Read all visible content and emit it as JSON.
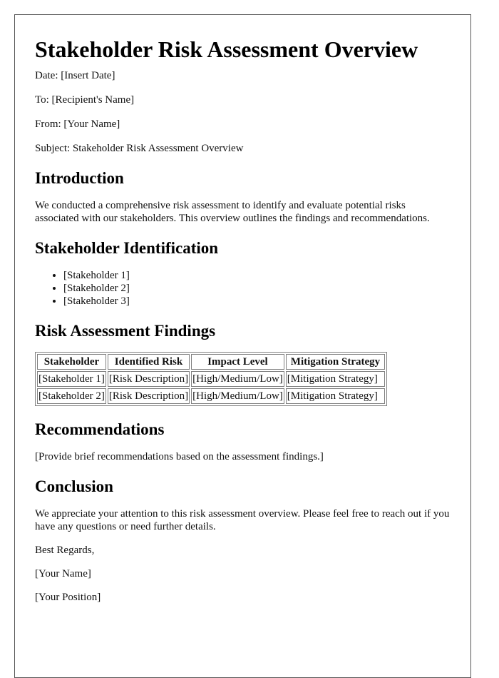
{
  "title": "Stakeholder Risk Assessment Overview",
  "meta": {
    "date": "Date: [Insert Date]",
    "to": "To: [Recipient's Name]",
    "from": "From: [Your Name]",
    "subject": "Subject: Stakeholder Risk Assessment Overview"
  },
  "introduction": {
    "heading": "Introduction",
    "body": "We conducted a comprehensive risk assessment to identify and evaluate potential risks associated with our stakeholders. This overview outlines the findings and recommendations."
  },
  "identification": {
    "heading": "Stakeholder Identification",
    "items": [
      "[Stakeholder 1]",
      "[Stakeholder 2]",
      "[Stakeholder 3]"
    ]
  },
  "findings": {
    "heading": "Risk Assessment Findings",
    "columns": [
      "Stakeholder",
      "Identified Risk",
      "Impact Level",
      "Mitigation Strategy"
    ],
    "rows": [
      [
        "[Stakeholder 1]",
        "[Risk Description]",
        "[High/Medium/Low]",
        "[Mitigation Strategy]"
      ],
      [
        "[Stakeholder 2]",
        "[Risk Description]",
        "[High/Medium/Low]",
        "[Mitigation Strategy]"
      ]
    ]
  },
  "recommendations": {
    "heading": "Recommendations",
    "body": "[Provide brief recommendations based on the assessment findings.]"
  },
  "conclusion": {
    "heading": "Conclusion",
    "body": "We appreciate your attention to this risk assessment overview. Please feel free to reach out if you have any questions or need further details."
  },
  "closing": {
    "salutation": "Best Regards,",
    "name": "[Your Name]",
    "position": "[Your Position]"
  }
}
